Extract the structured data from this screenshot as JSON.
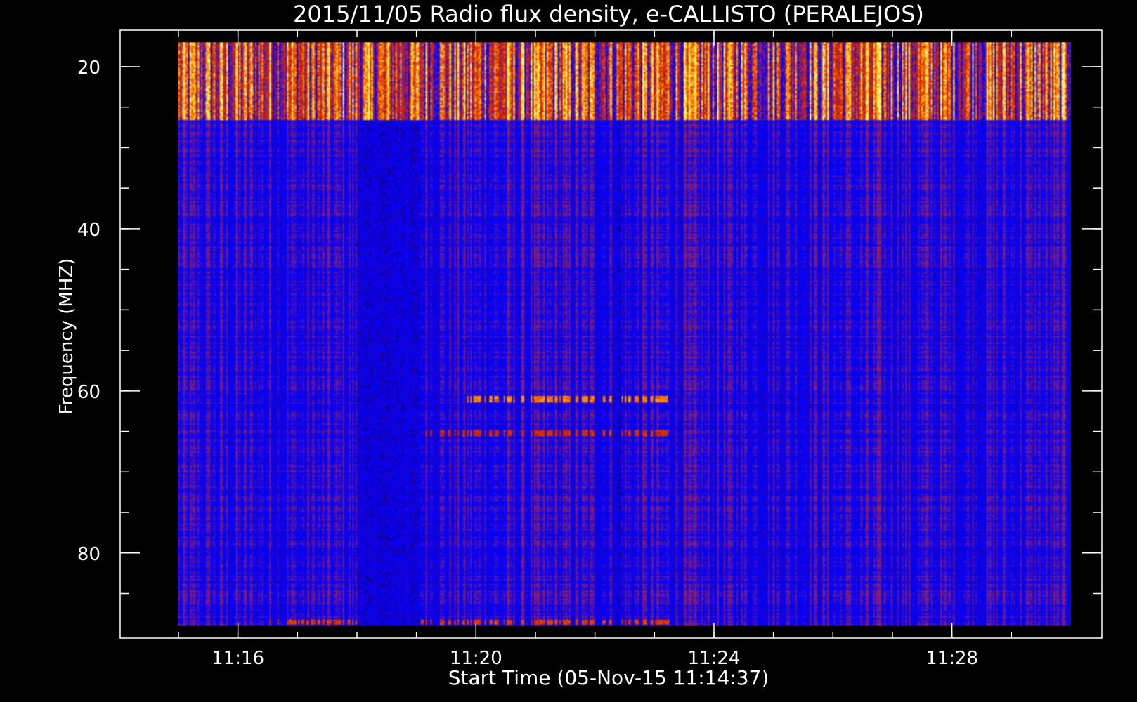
{
  "chart_data": {
    "type": "heatmap",
    "title": "2015/11/05  Radio flux density, e-CALLISTO (PERALEJOS)",
    "xlabel": "Start Time (05-Nov-15 11:14:37)",
    "ylabel": "Frequency (MHZ)",
    "x_tick_labels": [
      "11:16",
      "11:20",
      "11:24",
      "11:28"
    ],
    "x_tick_values_min": [
      1.38,
      5.38,
      9.38,
      13.38
    ],
    "x_minor_tick_values_min": [
      0.38,
      1.38,
      2.38,
      3.38,
      4.38,
      5.38,
      6.38,
      7.38,
      8.38,
      9.38,
      10.38,
      11.38,
      12.38,
      13.38,
      14.38
    ],
    "y_tick_labels": [
      "20",
      "40",
      "60",
      "80"
    ],
    "y_tick_values": [
      20,
      40,
      60,
      80
    ],
    "y_minor_tick_values": [
      20,
      25,
      30,
      35,
      40,
      45,
      50,
      55,
      60,
      65,
      70,
      75,
      80,
      85
    ],
    "xlim_min": [
      -0.6,
      15.9
    ],
    "ylim": [
      15.5,
      90.5
    ],
    "y_inverted": true,
    "data_extent_min": [
      0.38,
      15.38
    ],
    "data_extent_freq": [
      17,
      89
    ],
    "colormap": [
      "#000000",
      "#1a00c8",
      "#0000ff",
      "#7a1e80",
      "#d02000",
      "#ff8000",
      "#ffff60"
    ],
    "background_level": 0.35,
    "features": [
      {
        "name": "band",
        "f_from": 17,
        "f_to": 26.5,
        "level": 0.78
      },
      {
        "name": "line",
        "f": 61,
        "level": 0.82,
        "t_from": 5.2,
        "t_to": 8.6
      },
      {
        "name": "line",
        "f": 65.2,
        "level": 0.66,
        "t_from": 4.5,
        "t_to": 8.6
      },
      {
        "name": "line",
        "f": 88.5,
        "level": 0.7,
        "t_from": 1.8,
        "t_to": 8.7
      },
      {
        "name": "gap",
        "t_from": 3.38,
        "t_to": 4.45,
        "level": 0.1
      },
      {
        "name": "gap",
        "t_from": 7.72,
        "t_to": 7.82,
        "level": 0.1
      }
    ]
  }
}
